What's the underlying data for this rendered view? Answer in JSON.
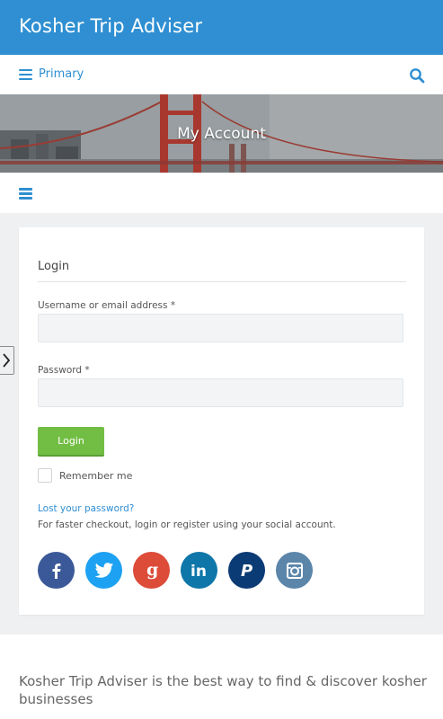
{
  "header": {
    "site_title": "Kosher Trip Adviser",
    "bg_color": "#2f8fd2"
  },
  "nav": {
    "menu_label": "Primary",
    "menu_icon": "hamburger-icon",
    "search_icon": "search-icon"
  },
  "banner": {
    "title": "My Account"
  },
  "subnav": {
    "menu_icon": "hamburger-icon"
  },
  "login": {
    "heading": "Login",
    "username_label": "Username or email address *",
    "username_value": "",
    "password_label": "Password *",
    "password_value": "",
    "submit_label": "Login",
    "remember_label": "Remember me",
    "remember_checked": false,
    "lost_password": "Lost your password?",
    "social_note": "For faster checkout, login or register using your social account."
  },
  "social": [
    {
      "name": "facebook",
      "icon": "facebook-icon",
      "color": "#3b5998"
    },
    {
      "name": "twitter",
      "icon": "twitter-icon",
      "color": "#1da1f2"
    },
    {
      "name": "google",
      "icon": "google-icon",
      "color": "#dd4b39"
    },
    {
      "name": "linkedin",
      "icon": "linkedin-icon",
      "color": "#0e76a8"
    },
    {
      "name": "paypal",
      "icon": "paypal-icon",
      "color": "#0b3b74"
    },
    {
      "name": "instagram",
      "icon": "instagram-icon",
      "color": "#5b86aa"
    }
  ],
  "footer": {
    "text": "Kosher Trip Adviser is the best way to find & discover kosher businesses"
  }
}
